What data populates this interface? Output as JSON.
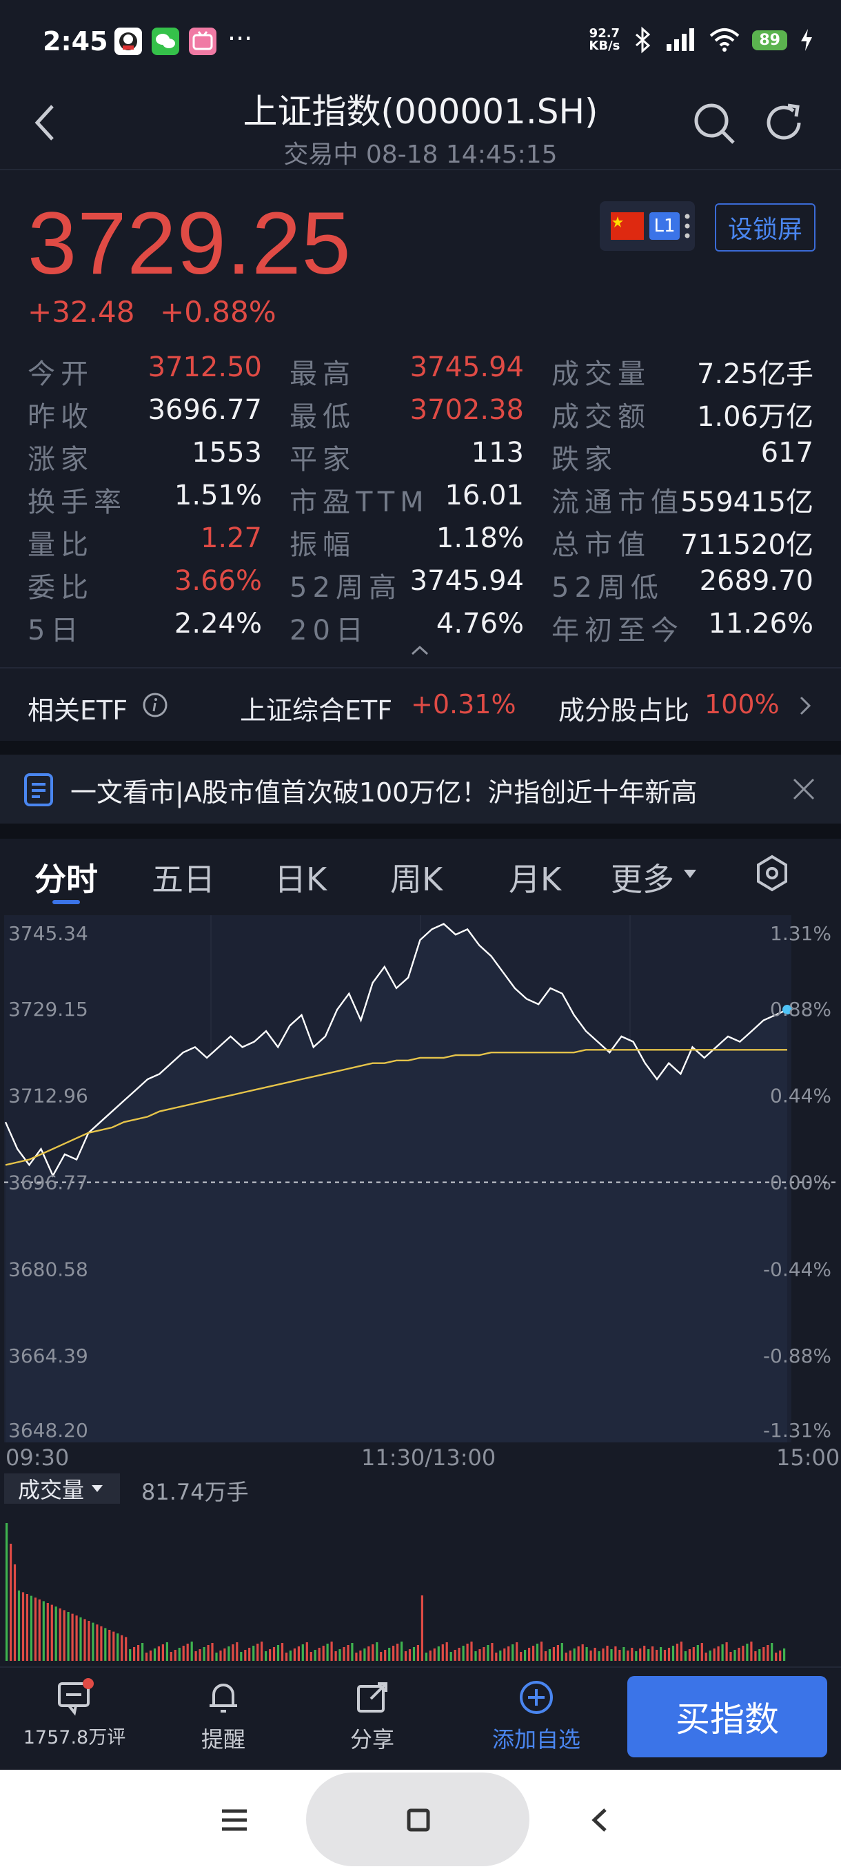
{
  "status_bar": {
    "time": "2:45",
    "dots": "···",
    "net_speed": "92.7",
    "net_unit": "KB/s",
    "battery": "89"
  },
  "header": {
    "title": "上证指数(000001.SH)",
    "subtitle": "交易中 08-18 14:45:15"
  },
  "quote": {
    "price": "3729.25",
    "change": "+32.48",
    "change_pct": "+0.88%",
    "level_badge": "L1",
    "lock_label": "设锁屏"
  },
  "stats": [
    [
      {
        "label": "今开",
        "value": "3712.50",
        "color": "red"
      },
      {
        "label": "最高",
        "value": "3745.94",
        "color": "red"
      },
      {
        "label": "成交量",
        "value": "7.25亿手",
        "color": "white"
      }
    ],
    [
      {
        "label": "昨收",
        "value": "3696.77",
        "color": "white"
      },
      {
        "label": "最低",
        "value": "3702.38",
        "color": "red"
      },
      {
        "label": "成交额",
        "value": "1.06万亿",
        "color": "white"
      }
    ],
    [
      {
        "label": "涨家",
        "value": "1553",
        "color": "white"
      },
      {
        "label": "平家",
        "value": "113",
        "color": "white"
      },
      {
        "label": "跌家",
        "value": "617",
        "color": "white"
      }
    ],
    [
      {
        "label": "换手率",
        "value": "1.51%",
        "color": "white"
      },
      {
        "label": "市盈TTM",
        "value": "16.01",
        "color": "white"
      },
      {
        "label": "流通市值",
        "value": "559415亿",
        "color": "white"
      }
    ],
    [
      {
        "label": "量比",
        "value": "1.27",
        "color": "red"
      },
      {
        "label": "振幅",
        "value": "1.18%",
        "color": "white"
      },
      {
        "label": "总市值",
        "value": "711520亿",
        "color": "white"
      }
    ],
    [
      {
        "label": "委比",
        "value": "3.66%",
        "color": "red"
      },
      {
        "label": "52周高",
        "value": "3745.94",
        "color": "white"
      },
      {
        "label": "52周低",
        "value": "2689.70",
        "color": "white"
      }
    ],
    [
      {
        "label": "5日",
        "value": "2.24%",
        "color": "white"
      },
      {
        "label": "20日",
        "value": "4.76%",
        "color": "white"
      },
      {
        "label": "年初至今",
        "value": "11.26%",
        "color": "white"
      }
    ]
  ],
  "etf": {
    "label": "相关ETF",
    "name": "上证综合ETF",
    "pct": "+0.31%",
    "comp_label": "成分股占比",
    "comp_value": "100%"
  },
  "news": {
    "text": "一文看市|A股市值首次破100万亿！沪指创近十年新高"
  },
  "tabs": [
    "分时",
    "五日",
    "日K",
    "周K",
    "月K",
    "更多"
  ],
  "chart_data": {
    "type": "line",
    "left_ticks": [
      "3745.34",
      "3729.15",
      "3712.96",
      "3696.77",
      "3680.58",
      "3664.39",
      "3648.20"
    ],
    "right_ticks": [
      "1.31%",
      "0.88%",
      "0.44%",
      "0.00%",
      "-0.44%",
      "-0.88%",
      "-1.31%"
    ],
    "x_ticks": [
      "09:30",
      "11:30/13:00",
      "15:00"
    ],
    "ylim": [
      3648.2,
      3745.34
    ],
    "prev_close": 3696.77,
    "series": [
      {
        "values": [
          3708,
          3703,
          3700,
          3703,
          3698,
          3702,
          3701,
          3706,
          3708,
          3710,
          3712,
          3714,
          3716,
          3717,
          3719,
          3721,
          3722,
          3720,
          3722,
          3724,
          3722,
          3723,
          3725,
          3722,
          3726,
          3728,
          3722,
          3724,
          3729,
          3732,
          3727,
          3734,
          3737,
          3733,
          3735,
          3742,
          3744,
          3745,
          3743,
          3744,
          3741,
          3739,
          3736,
          3733,
          3731,
          3730,
          3733,
          3732,
          3728,
          3725,
          3723,
          3721,
          3724,
          3723,
          3719,
          3716,
          3719,
          3717,
          3722,
          3720,
          3722,
          3724,
          3723,
          3725,
          3727,
          3728,
          3729
        ]
      },
      {
        "values": [
          3700,
          3700.5,
          3701,
          3702,
          3703,
          3704,
          3705,
          3706,
          3706.5,
          3707,
          3708,
          3708.5,
          3709,
          3710,
          3710.5,
          3711,
          3711.5,
          3712,
          3712.5,
          3713,
          3713.5,
          3714,
          3714.5,
          3715,
          3715.5,
          3716,
          3716.5,
          3717,
          3717.5,
          3718,
          3718.5,
          3719,
          3719,
          3719.5,
          3719.5,
          3720,
          3720,
          3720,
          3720.5,
          3720.5,
          3720.5,
          3721,
          3721,
          3721,
          3721,
          3721,
          3721,
          3721,
          3721,
          3721.5,
          3721.5,
          3721.5,
          3721.5,
          3721.5,
          3721.5,
          3721.5,
          3721.5,
          3721.5,
          3721.5,
          3721.5,
          3721.5,
          3721.5,
          3721.5,
          3721.5,
          3721.5,
          3721.5,
          3721.5
        ]
      }
    ],
    "volume_label": "成交量",
    "volume_value": "81.74万手"
  },
  "bottom": {
    "comments": "1757.8万评",
    "alert": "提醒",
    "share": "分享",
    "watch": "添加自选",
    "buy": "买指数"
  },
  "colors": {
    "up": "#e04b45",
    "down": "#3fb34f",
    "accent": "#3b74e8",
    "line": "#ffffff",
    "avg": "#e6c44a"
  }
}
